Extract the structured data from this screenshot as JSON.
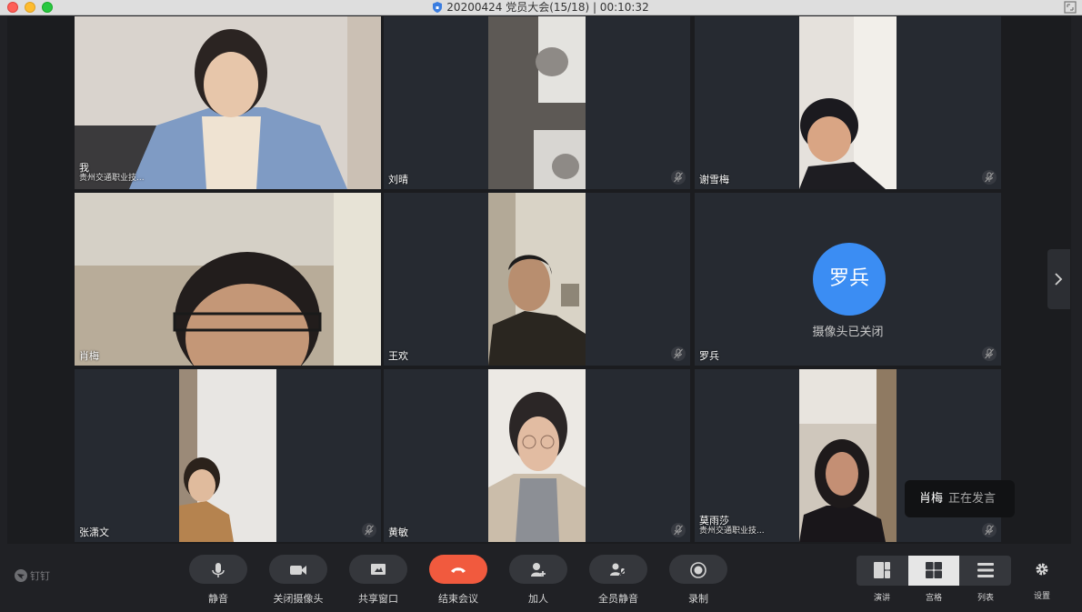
{
  "window": {
    "title": "20200424 党员大会(15/18) | 00:10:32"
  },
  "colors": {
    "accent_speaking": "#55c25a",
    "end_call": "#f15a3e",
    "avatar_blue": "#3b8df3"
  },
  "participants": [
    {
      "name": "我",
      "org": "贵州交通职业技...",
      "muted": false,
      "camera": "on"
    },
    {
      "name": "刘晴",
      "org": "",
      "muted": true,
      "camera": "on"
    },
    {
      "name": "谢雪梅",
      "org": "",
      "muted": true,
      "camera": "on"
    },
    {
      "name": "肖梅",
      "org": "",
      "muted": false,
      "camera": "on",
      "active_speaker": true
    },
    {
      "name": "王欢",
      "org": "",
      "muted": true,
      "camera": "on"
    },
    {
      "name": "罗兵",
      "org": "",
      "muted": true,
      "camera": "off",
      "avatar_text": "罗兵",
      "camera_off_text": "摄像头已关闭"
    },
    {
      "name": "张潇文",
      "org": "",
      "muted": true,
      "camera": "on"
    },
    {
      "name": "黄敏",
      "org": "",
      "muted": true,
      "camera": "on"
    },
    {
      "name": "莫雨莎",
      "org": "贵州交通职业技...",
      "muted": true,
      "camera": "on"
    }
  ],
  "speaking_toast": {
    "name": "肖梅",
    "status": "正在发言"
  },
  "toolbar": {
    "brand": "钉钉",
    "buttons": [
      {
        "label": "静音",
        "icon": "microphone-icon"
      },
      {
        "label": "关闭摄像头",
        "icon": "video-camera-icon"
      },
      {
        "label": "共享窗口",
        "icon": "share-screen-icon"
      },
      {
        "label": "结束会议",
        "icon": "hang-up-icon"
      },
      {
        "label": "加人",
        "icon": "add-person-icon"
      },
      {
        "label": "全员静音",
        "icon": "mute-all-icon"
      },
      {
        "label": "录制",
        "icon": "record-icon"
      }
    ],
    "layouts": [
      {
        "label": "演讲",
        "icon": "speaker-layout-icon",
        "selected": false
      },
      {
        "label": "宫格",
        "icon": "grid-layout-icon",
        "selected": true
      },
      {
        "label": "列表",
        "icon": "list-layout-icon",
        "selected": false
      }
    ],
    "settings_label": "设置"
  }
}
